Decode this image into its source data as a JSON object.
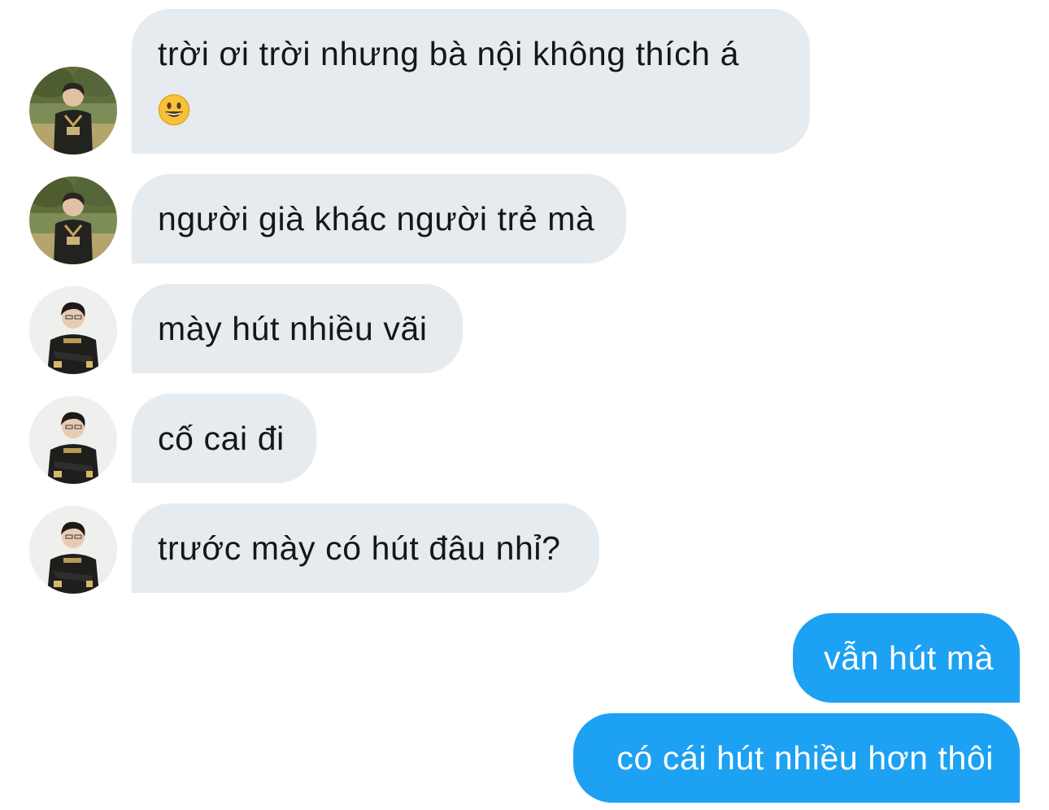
{
  "conversation": {
    "messages": [
      {
        "text": "trời ơi trời nhưng bà nội không thích á",
        "emoji": "grinning-face-emoji"
      },
      {
        "text": "người già khác người trẻ mà"
      },
      {
        "text": "mày hút nhiều vãi"
      },
      {
        "text": "cố cai đi"
      },
      {
        "text": "trước mày có hút đâu nhỉ?"
      },
      {
        "text": "vẫn hút mà"
      },
      {
        "text": "có cái hút nhiều hơn thôi"
      }
    ]
  },
  "avatars": {
    "contact_a": {
      "name": "avatar-outdoor-jersey",
      "bg": "#7a8a5a"
    },
    "contact_b": {
      "name": "avatar-studio-jacket",
      "bg": "#eeeeec"
    }
  },
  "colors": {
    "incoming_bubble": "#e6ebef",
    "incoming_text": "#14171a",
    "outgoing_bubble": "#1da1f2",
    "outgoing_text": "#ffffff"
  }
}
